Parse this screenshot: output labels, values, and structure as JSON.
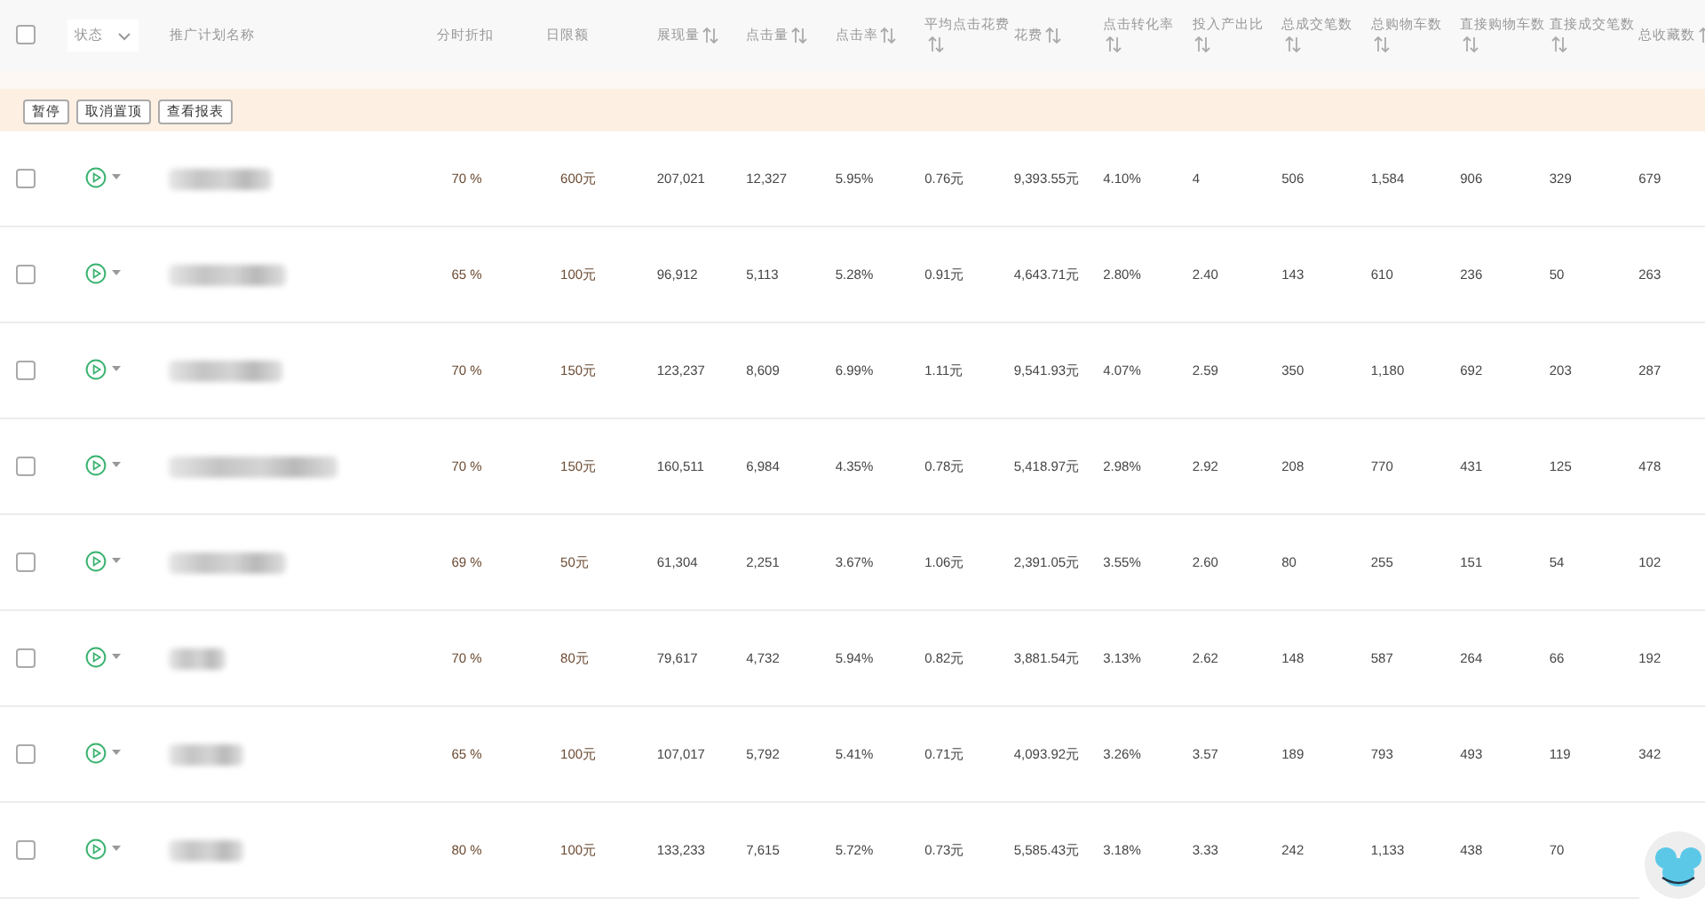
{
  "header": {
    "checkbox": {
      "checked": false
    },
    "status_filter": {
      "label": "状态"
    },
    "columns": [
      {
        "label": "推广计划名称",
        "sortable": false
      },
      {
        "label": "分时折扣",
        "sortable": false
      },
      {
        "label": "日限额",
        "sortable": false
      },
      {
        "label": "展现量",
        "sortable": true
      },
      {
        "label": "点击量",
        "sortable": true
      },
      {
        "label": "点击率",
        "sortable": true
      },
      {
        "label": "平均点击花费",
        "sortable": true
      },
      {
        "label": "花费",
        "sortable": true
      },
      {
        "label": "点击转化率",
        "sortable": true
      },
      {
        "label": "投入产出比",
        "sortable": true
      },
      {
        "label": "总成交笔数",
        "sortable": true
      },
      {
        "label": "总购物车数",
        "sortable": true
      },
      {
        "label": "直接购物车数",
        "sortable": true
      },
      {
        "label": "直接成交笔数",
        "sortable": true
      },
      {
        "label": "总收藏数",
        "sortable": true
      }
    ]
  },
  "actions": [
    "暂停",
    "取消置顶",
    "查看报表"
  ],
  "rows": [
    {
      "checked": false,
      "cells": [
        "70 %",
        "600元",
        "207,021",
        "12,327",
        "5.95%",
        "0.76元",
        "9,393.55元",
        "4.10%",
        "4",
        "506",
        "1,584",
        "906",
        "329",
        "679"
      ]
    },
    {
      "checked": false,
      "cells": [
        "65 %",
        "100元",
        "96,912",
        "5,113",
        "5.28%",
        "0.91元",
        "4,643.71元",
        "2.80%",
        "2.40",
        "143",
        "610",
        "236",
        "50",
        "263"
      ]
    },
    {
      "checked": false,
      "cells": [
        "70 %",
        "150元",
        "123,237",
        "8,609",
        "6.99%",
        "1.11元",
        "9,541.93元",
        "4.07%",
        "2.59",
        "350",
        "1,180",
        "692",
        "203",
        "287"
      ]
    },
    {
      "checked": false,
      "cells": [
        "70 %",
        "150元",
        "160,511",
        "6,984",
        "4.35%",
        "0.78元",
        "5,418.97元",
        "2.98%",
        "2.92",
        "208",
        "770",
        "431",
        "125",
        "478"
      ]
    },
    {
      "checked": false,
      "cells": [
        "69 %",
        "50元",
        "61,304",
        "2,251",
        "3.67%",
        "1.06元",
        "2,391.05元",
        "3.55%",
        "2.60",
        "80",
        "255",
        "151",
        "54",
        "102"
      ]
    },
    {
      "checked": false,
      "cells": [
        "70 %",
        "80元",
        "79,617",
        "4,732",
        "5.94%",
        "0.82元",
        "3,881.54元",
        "3.13%",
        "2.62",
        "148",
        "587",
        "264",
        "66",
        "192"
      ]
    },
    {
      "checked": false,
      "cells": [
        "65 %",
        "100元",
        "107,017",
        "5,792",
        "5.41%",
        "0.71元",
        "4,093.92元",
        "3.26%",
        "3.57",
        "189",
        "793",
        "493",
        "119",
        "342"
      ]
    },
    {
      "checked": false,
      "cells": [
        "80 %",
        "100元",
        "133,233",
        "7,615",
        "5.72%",
        "0.73元",
        "5,585.43元",
        "3.18%",
        "3.33",
        "242",
        "1,133",
        "438",
        "70"
      ]
    }
  ]
}
